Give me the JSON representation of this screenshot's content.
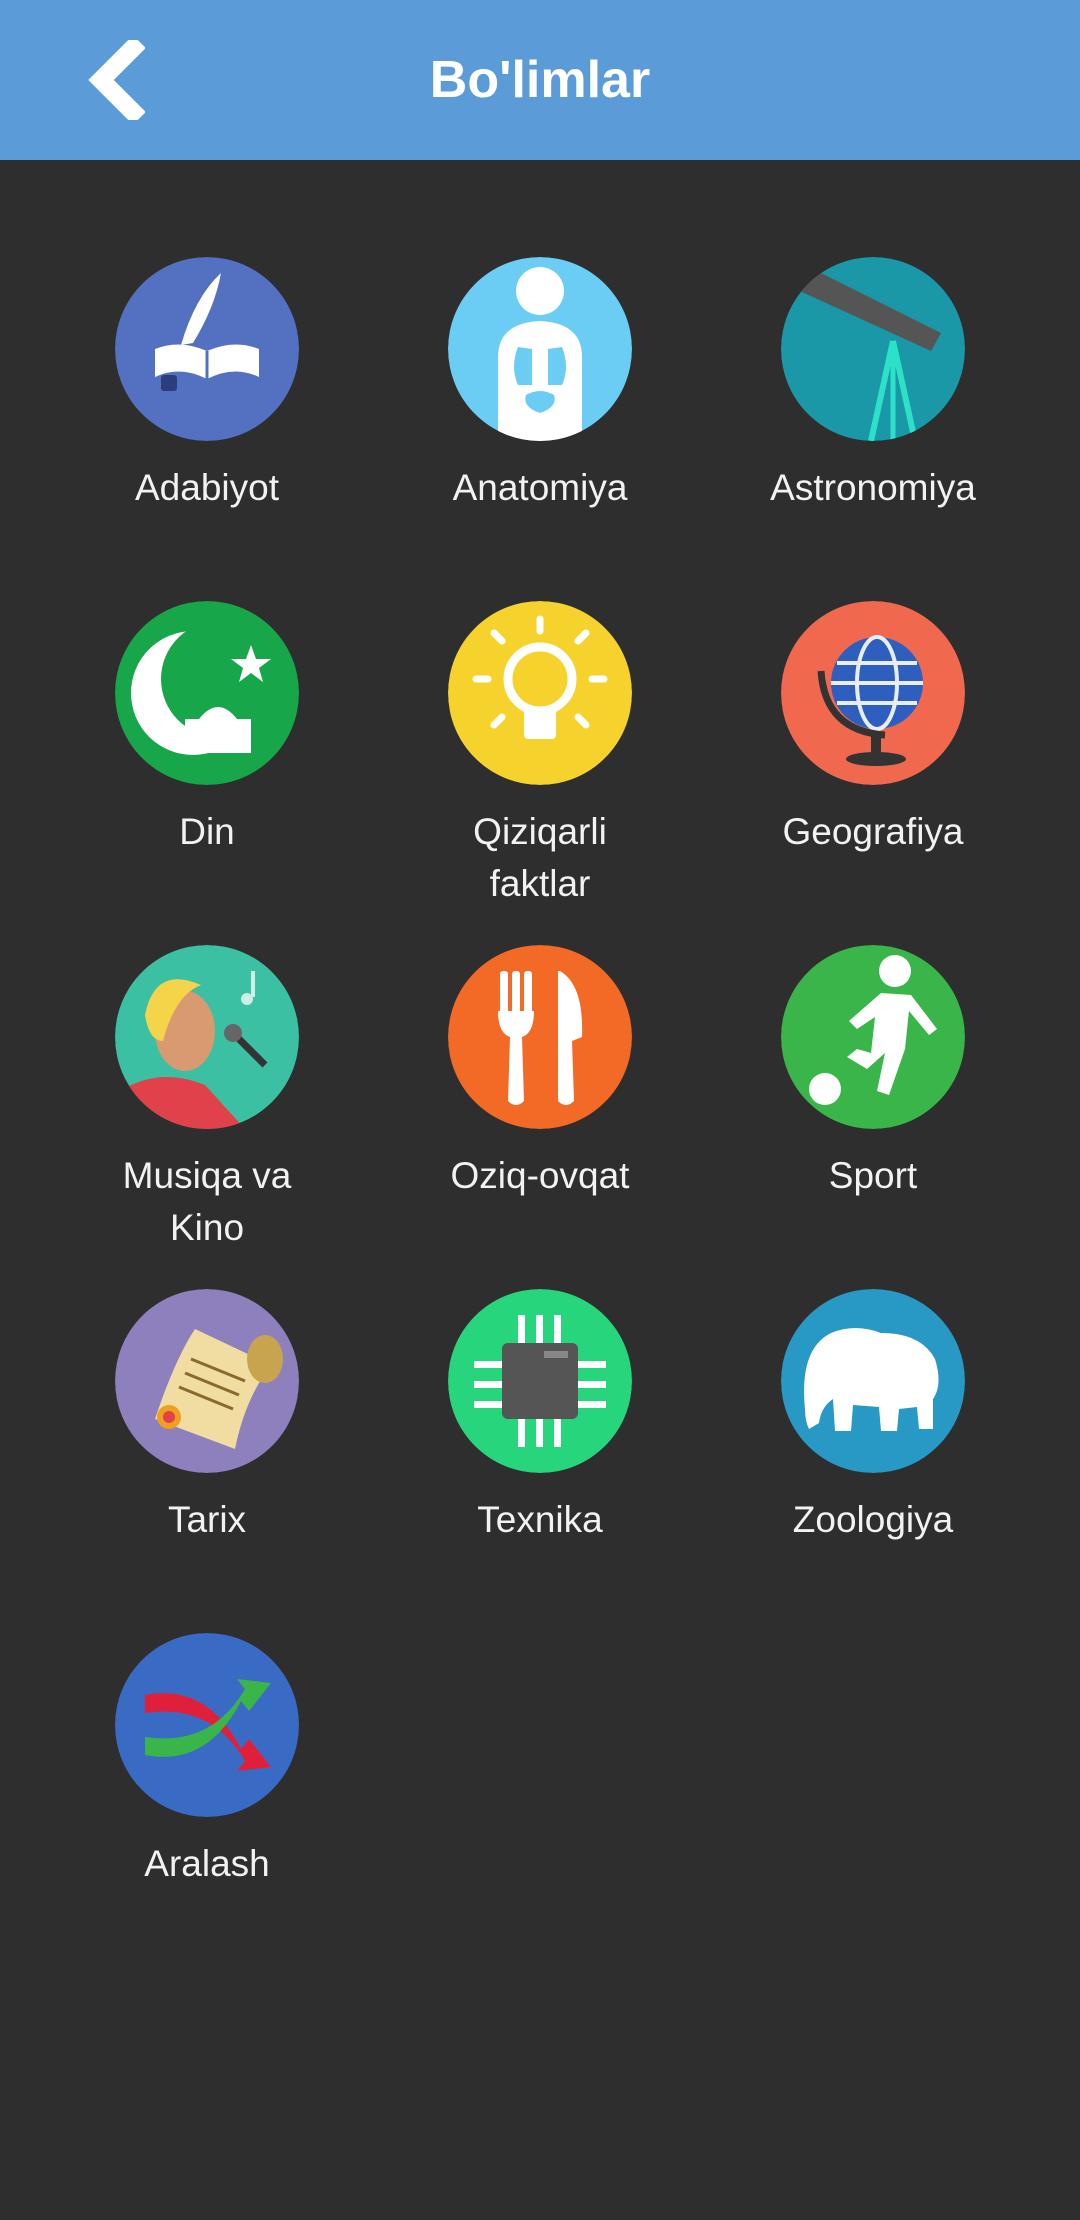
{
  "header": {
    "title": "Bo'limlar",
    "back_icon": "chevron-left-icon",
    "background": "#5b9bd8"
  },
  "categories": [
    {
      "label": "Adabiyot",
      "icon": "book-quill-icon",
      "color": "#5470c0"
    },
    {
      "label": "Anatomiya",
      "icon": "human-body-icon",
      "color": "#6ccdf4"
    },
    {
      "label": "Astronomiya",
      "icon": "telescope-icon",
      "color": "#1a98a8"
    },
    {
      "label": "Din",
      "icon": "crescent-mosque-icon",
      "color": "#18a64a"
    },
    {
      "label": "Qiziqarli\nfaktlar",
      "icon": "lightbulb-icon",
      "color": "#f6d22c"
    },
    {
      "label": "Geografiya",
      "icon": "globe-icon",
      "color": "#f0694f"
    },
    {
      "label": "Musiqa va\nKino",
      "icon": "singer-icon",
      "color": "#3cc0a4"
    },
    {
      "label": "Oziq-ovqat",
      "icon": "fork-knife-icon",
      "color": "#f26a25"
    },
    {
      "label": "Sport",
      "icon": "football-player-icon",
      "color": "#3ab54a"
    },
    {
      "label": "Tarix",
      "icon": "scroll-icon",
      "color": "#8d80bd"
    },
    {
      "label": "Texnika",
      "icon": "microchip-icon",
      "color": "#27d57d"
    },
    {
      "label": "Zoologiya",
      "icon": "elephant-icon",
      "color": "#2898c4"
    },
    {
      "label": "Aralash",
      "icon": "shuffle-arrows-icon",
      "color": "#3a6bc4"
    }
  ]
}
